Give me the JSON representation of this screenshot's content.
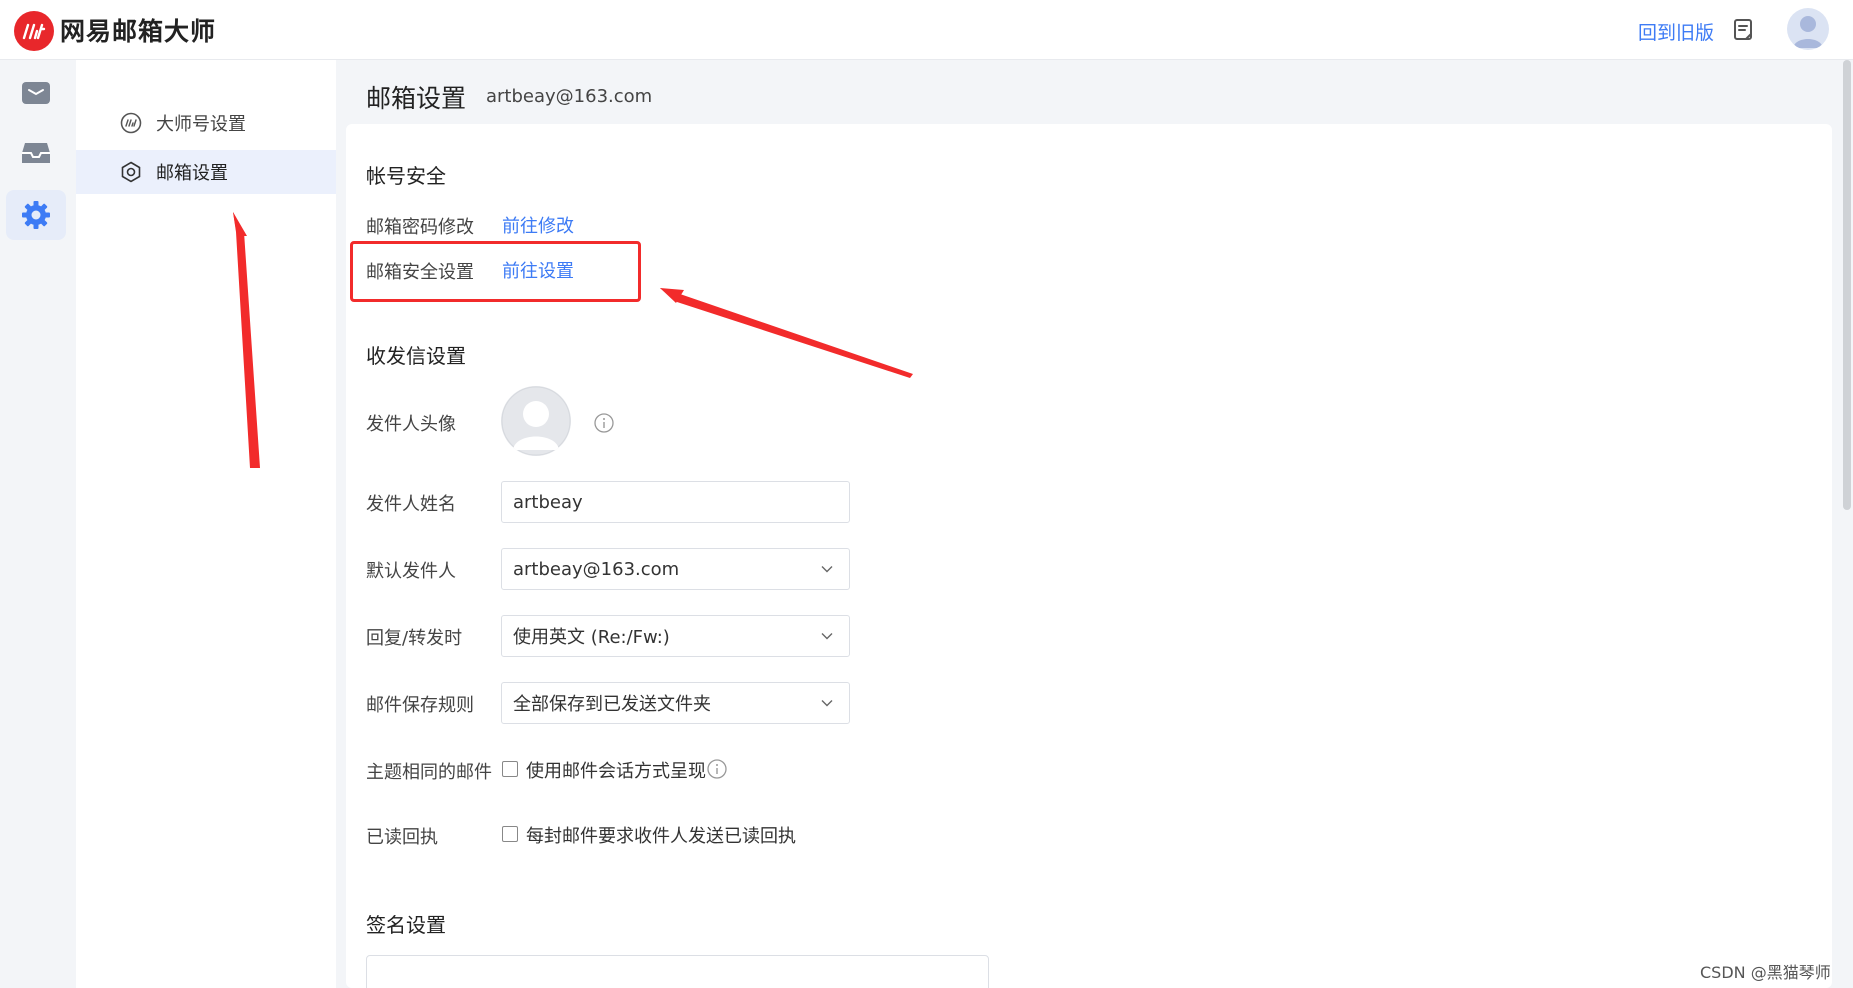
{
  "app": {
    "title": "网易邮箱大师",
    "back_to_old": "回到旧版"
  },
  "rail": [
    "mail-icon",
    "inbox-icon",
    "settings-gear-icon"
  ],
  "sidebar": {
    "items": [
      {
        "label": "大师号设置",
        "icon": "master-account-icon",
        "active": false
      },
      {
        "label": "邮箱设置",
        "icon": "mailbox-settings-icon",
        "active": true
      }
    ]
  },
  "main": {
    "title": "邮箱设置",
    "email": "artbeay@163.com"
  },
  "account_security": {
    "title": "帐号安全",
    "password_label": "邮箱密码修改",
    "password_link": "前往修改",
    "security_label": "邮箱安全设置",
    "security_link": "前往设置"
  },
  "send_receive": {
    "title": "收发信设置",
    "avatar_label": "发件人头像",
    "name_label": "发件人姓名",
    "name_value": "artbeay",
    "default_sender_label": "默认发件人",
    "default_sender_value": "artbeay@163.com",
    "reply_label": "回复/转发时",
    "reply_value": "使用英文 (Re:/Fw:)",
    "save_rule_label": "邮件保存规则",
    "save_rule_value": "全部保存到已发送文件夹",
    "same_subject_label": "主题相同的邮件",
    "same_subject_check": "使用邮件会话方式呈现",
    "same_subject_checked": false,
    "read_receipt_label": "已读回执",
    "read_receipt_check": "每封邮件要求收件人发送已读回执",
    "read_receipt_checked": false
  },
  "signature": {
    "title": "签名设置"
  },
  "annotation_color": "#f22b2b",
  "accent_color": "#3d7bf5",
  "watermark": "CSDN @黑猫琴师"
}
